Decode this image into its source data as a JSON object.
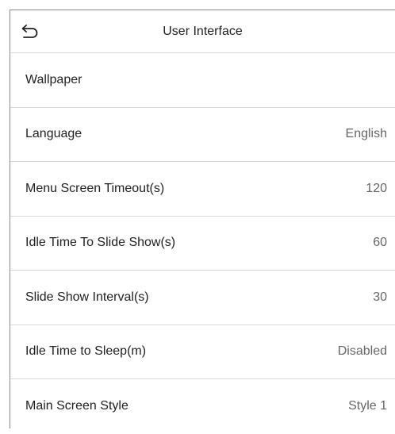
{
  "header": {
    "title": "User Interface",
    "back_icon": "back-arrow-icon"
  },
  "items": [
    {
      "label": "Wallpaper",
      "value": ""
    },
    {
      "label": "Language",
      "value": "English"
    },
    {
      "label": "Menu Screen Timeout(s)",
      "value": "120"
    },
    {
      "label": "Idle Time To Slide Show(s)",
      "value": "60"
    },
    {
      "label": "Slide Show Interval(s)",
      "value": "30"
    },
    {
      "label": "Idle Time to Sleep(m)",
      "value": "Disabled"
    },
    {
      "label": "Main Screen Style",
      "value": "Style 1"
    }
  ],
  "colors": {
    "text": "#222222",
    "value_text": "#666666",
    "divider": "#d8d8d8",
    "frame": "#8a8a8a"
  }
}
